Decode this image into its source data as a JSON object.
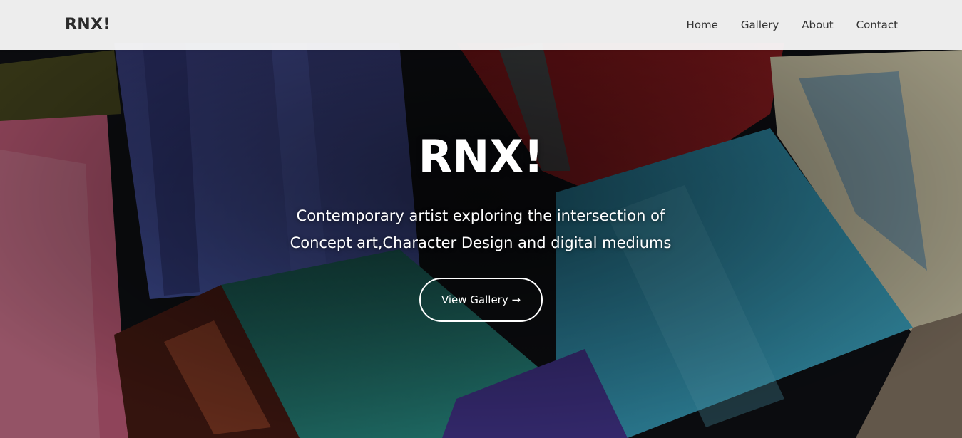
{
  "header": {
    "brand": "RNX!",
    "nav": [
      {
        "label": "Home"
      },
      {
        "label": "Gallery"
      },
      {
        "label": "About"
      },
      {
        "label": "Contact"
      }
    ]
  },
  "hero": {
    "title": "RNX!",
    "subtitle_line1": "Contemporary artist exploring the intersection of",
    "subtitle_line2": "Concept art,Character Design and digital mediums",
    "cta_label": "View Gallery →",
    "background": "paintbrushes-photo"
  },
  "colors": {
    "header_bg": "#fafafa",
    "brand_text": "#2b2b2b",
    "nav_text": "#333333",
    "hero_text": "#ffffff"
  }
}
